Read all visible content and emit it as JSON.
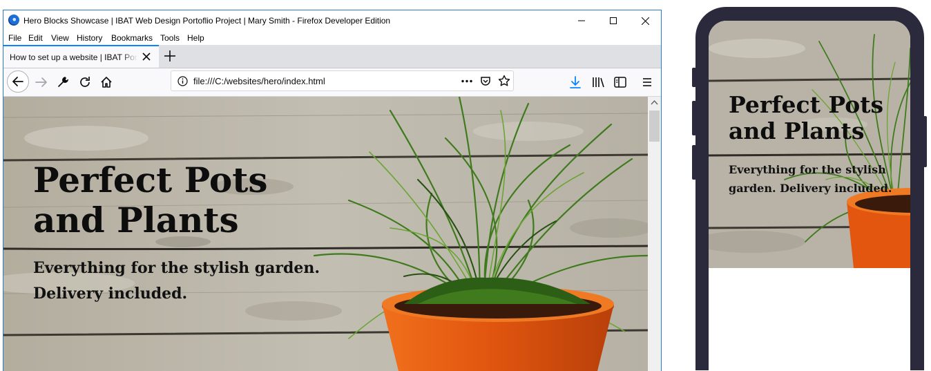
{
  "window": {
    "title": "Hero Blocks Showcase | IBAT Web Design Portoflio Project | Mary Smith - Firefox Developer Edition",
    "controls": [
      "minimize",
      "maximize",
      "close"
    ]
  },
  "menu": [
    "File",
    "Edit",
    "View",
    "History",
    "Bookmarks",
    "Tools",
    "Help"
  ],
  "tab": {
    "label": "How to set up a website | IBAT Portfolio"
  },
  "navbar": {
    "url": "file:///C:/websites/hero/index.html",
    "icons": [
      "back-icon",
      "forward-icon",
      "wrench-icon",
      "reload-icon",
      "home-icon",
      "info-icon",
      "page-actions-icon",
      "pocket-icon",
      "bookmark-star-icon",
      "download-icon",
      "library-icon",
      "sidebar-icon",
      "menu-icon"
    ]
  },
  "hero": {
    "title": "Perfect Pots and Plants",
    "subtitle": "Everything for the stylish garden. Delivery included."
  },
  "phone": {
    "title": "Perfect Pots and Plants",
    "subtitle": "Everything for the stylish garden. Delivery included."
  },
  "colors": {
    "accent": "#0a84ff",
    "window_border": "#2b79c2",
    "wood": "#b8b3a6",
    "pot": "#e2560f",
    "phone_frame": "#2a2a3c"
  }
}
